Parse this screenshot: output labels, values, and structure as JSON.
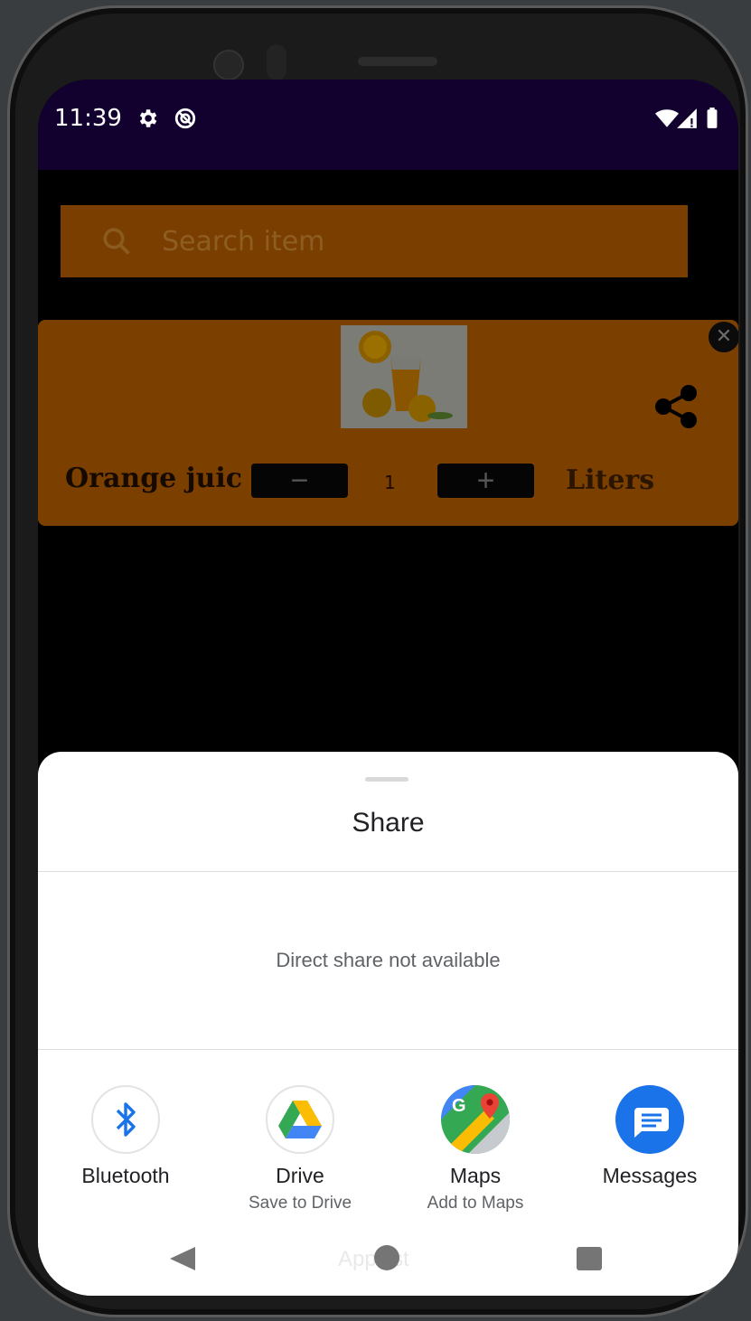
{
  "status_bar": {
    "time": "11:39",
    "icons": [
      "gear-icon",
      "sync-icon",
      "wifi-icon",
      "signal-icon",
      "battery-icon"
    ]
  },
  "search": {
    "placeholder": "Search item",
    "icon": "search-icon"
  },
  "item_card": {
    "name": "Orange juic",
    "quantity": "1",
    "unit": "Liters",
    "decrement_label": "−",
    "increment_label": "+",
    "image": "orange-juice-image"
  },
  "share_sheet": {
    "title": "Share",
    "direct_share_message": "Direct share not available",
    "targets": [
      {
        "label": "Bluetooth",
        "sublabel": "",
        "icon": "bluetooth-icon"
      },
      {
        "label": "Drive",
        "sublabel": "Save to Drive",
        "icon": "drive-icon"
      },
      {
        "label": "Maps",
        "sublabel": "Add to Maps",
        "icon": "maps-icon"
      },
      {
        "label": "Messages",
        "sublabel": "",
        "icon": "messages-icon"
      }
    ],
    "hidden_text": "App list"
  },
  "colors": {
    "status_bar": "#12002e",
    "card_background": "#7b3f00",
    "sheet_background": "#ffffff",
    "bluetooth_blue": "#1a73e8",
    "messages_blue": "#1a73e8"
  }
}
